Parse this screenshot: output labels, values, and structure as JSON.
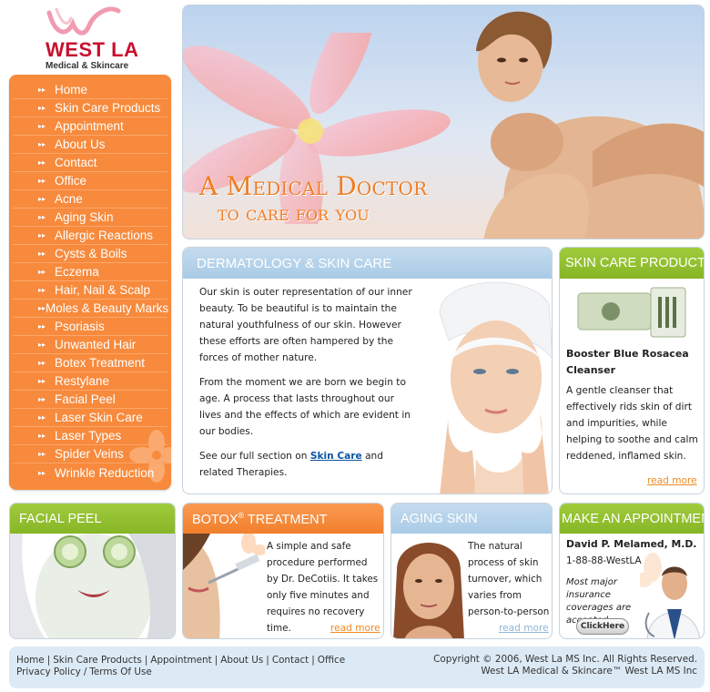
{
  "brand": {
    "name": "WEST LA",
    "tagline": "Medical & Skincare"
  },
  "nav": {
    "items": [
      {
        "label": "Home"
      },
      {
        "label": "Skin Care Products"
      },
      {
        "label": "Appointment"
      },
      {
        "label": "About Us"
      },
      {
        "label": "Contact"
      },
      {
        "label": "Office"
      },
      {
        "label": "Acne"
      },
      {
        "label": "Aging Skin"
      },
      {
        "label": "Allergic Reactions"
      },
      {
        "label": "Cysts & Boils"
      },
      {
        "label": "Eczema"
      },
      {
        "label": "Hair, Nail & Scalp"
      },
      {
        "label": "Moles & Beauty Marks"
      },
      {
        "label": "Psoriasis"
      },
      {
        "label": "Unwanted Hair"
      },
      {
        "label": "Botex Treatment"
      },
      {
        "label": "Restylane"
      },
      {
        "label": "Facial Peel"
      },
      {
        "label": "Laser Skin Care"
      },
      {
        "label": "Laser Types"
      },
      {
        "label": "Spider Veins"
      },
      {
        "label": "Wrinkle Reduction"
      }
    ]
  },
  "hero": {
    "title": "A Medical Doctor",
    "subtitle": "to care for you"
  },
  "dermatology": {
    "title": "DERMATOLOGY & SKIN CARE",
    "para1": "Our skin is outer representation of our inner beauty. To be beautiful is to maintain the natural youthfulness of our skin. However these efforts are often hampered by the forces of mother nature.",
    "para2": "From the moment we are born we begin to age. A process that lasts throughout our lives and the effects of which are evident in our bodies.",
    "para3_pre": "See our full section on ",
    "para3_link": "Skin Care",
    "para3_post": " and related Therapies."
  },
  "products": {
    "title": "SKIN CARE PRODUCTS",
    "name": "Booster Blue Rosacea Cleanser",
    "description": "A gentle cleanser that effectively rids skin of dirt and impurities, while helping to soothe and calm reddened, inflamed skin.",
    "read_more": "read more"
  },
  "facial_peel": {
    "title": "FACIAL PEEL"
  },
  "botox": {
    "title": "BOTOX",
    "title_mark": "®",
    "title_rest": " TREATMENT",
    "text": "A simple and safe procedure performed by Dr. DeCotiis. It takes only five minutes and requires no recovery time.",
    "read_more": "read more"
  },
  "aging": {
    "title": "AGING SKIN",
    "text": "The natural process of skin turnover, which varies from person-to-person",
    "read_more": "read more"
  },
  "appointment": {
    "title": "MAKE AN APPOINTMENT",
    "doctor": "David P. Melamed, M.D.",
    "phone": "1-88-88-WestLA",
    "note": "Most major insurance coverages are accepted",
    "button": "ClickHere"
  },
  "footer": {
    "links": [
      "Home",
      "Skin Care Products",
      "Appointment",
      "About Us",
      "Contact",
      "Office"
    ],
    "privacy": "Privacy Policy",
    "terms": "Terms Of Use",
    "copyright1": "Copyright © 2006, West La MS Inc. All Rights Reserved.",
    "copyright2": "West LA Medical & Skincare™ West LA MS Inc"
  },
  "colors": {
    "nav_orange": "#f78a3c",
    "green_header": "#93c030",
    "blue_header": "#b5d3ea",
    "brand_red": "#c8102e",
    "link_blue": "#0a56a3",
    "read_more_orange": "#f08a23"
  }
}
